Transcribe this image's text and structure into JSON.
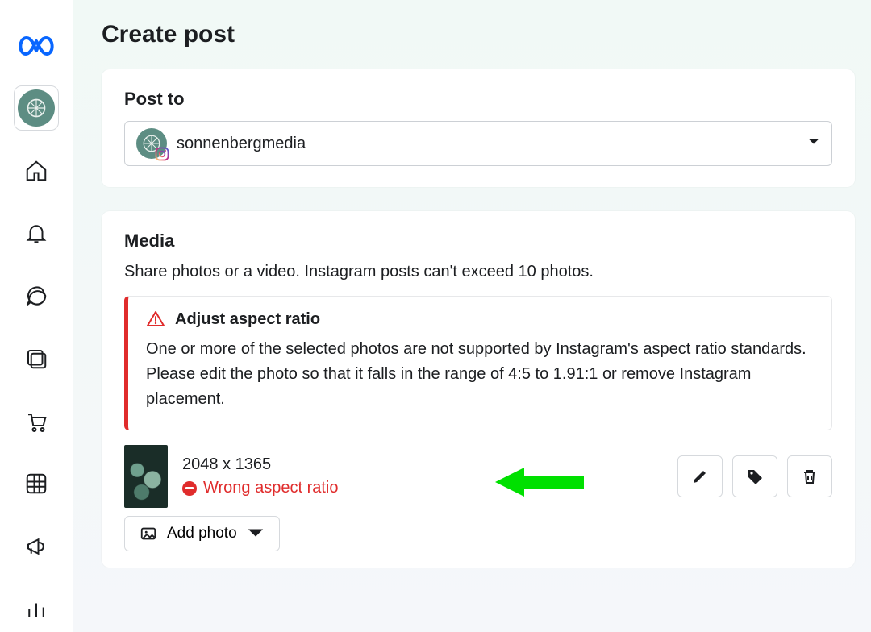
{
  "page": {
    "title": "Create post"
  },
  "post_to": {
    "section_title": "Post to",
    "account_name": "sonnenbergmedia"
  },
  "media": {
    "section_title": "Media",
    "description": "Share photos or a video. Instagram posts can't exceed 10 photos.",
    "warning": {
      "title": "Adjust aspect ratio",
      "body": "One or more of the selected photos are not supported by Instagram's aspect ratio standards. Please edit the photo so that it falls in the range of 4:5 to 1.91:1 or remove Instagram placement."
    },
    "item": {
      "dimensions": "2048 x 1365",
      "error_label": "Wrong aspect ratio"
    },
    "add_photo_label": "Add photo"
  },
  "sidebar": {
    "icons": [
      "meta-logo",
      "profile-avatar",
      "home",
      "notifications",
      "messages",
      "planner",
      "commerce",
      "insights-grid",
      "ads",
      "bar-chart"
    ]
  },
  "annotation": {
    "arrow_color": "#00e000"
  }
}
